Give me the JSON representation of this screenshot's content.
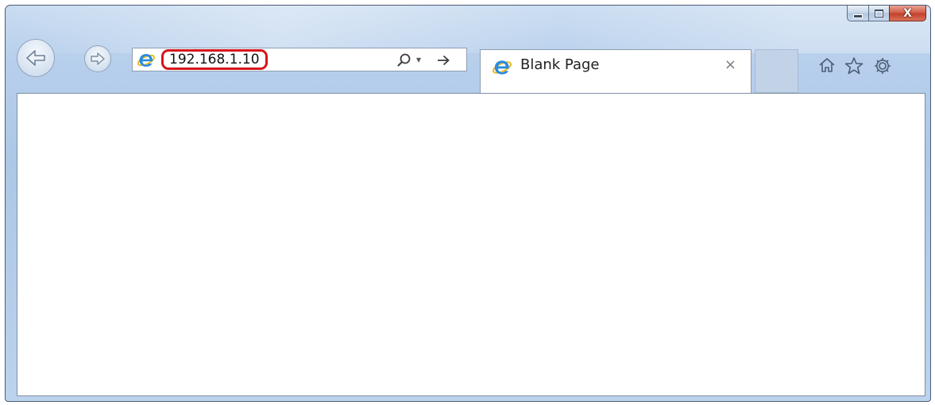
{
  "address_bar": {
    "url": "192.168.1.10"
  },
  "tab": {
    "title": "Blank Page",
    "close_glyph": "×"
  },
  "caption": {
    "close_glyph": "X"
  },
  "icons": {
    "back": "back-arrow-icon",
    "forward": "forward-arrow-icon",
    "search": "search-icon",
    "dropdown": "chevron-down-icon",
    "go": "go-arrow-icon",
    "home": "home-icon",
    "favorites": "star-icon",
    "tools": "gear-icon",
    "browser": "ie-logo-icon"
  },
  "colors": {
    "url_highlight": "#d6141b",
    "ie_logo": "#2a8be0",
    "close_button": "#c2412a"
  }
}
